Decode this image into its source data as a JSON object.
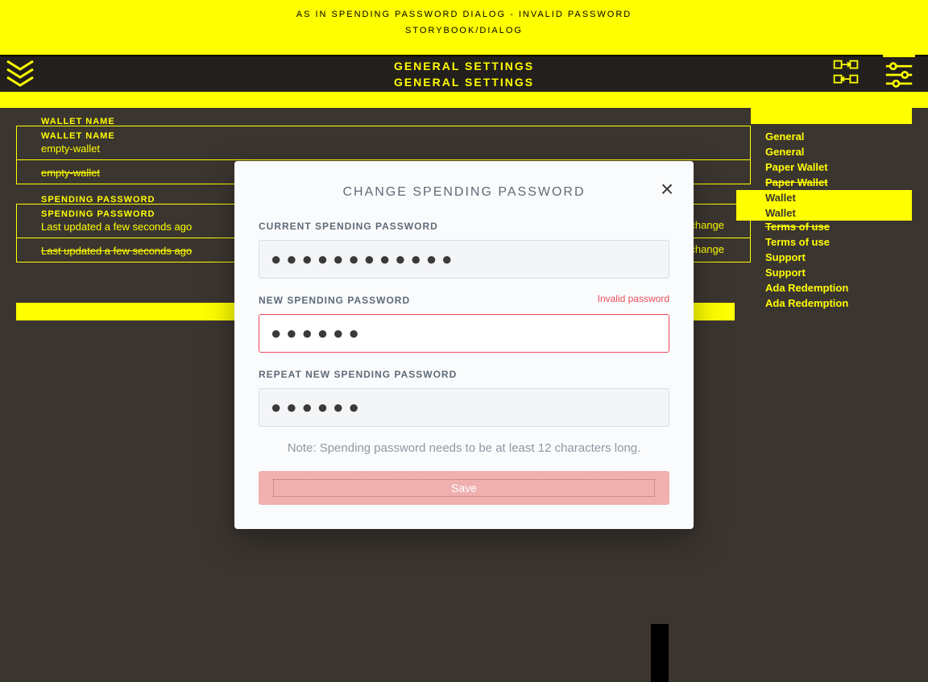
{
  "announcement": {
    "line1": "AS IN SPENDING PASSWORD DIALOG - INVALID PASSWORD",
    "line2": "STORYBOOK/DIALOG"
  },
  "header": {
    "title1": "GENERAL SETTINGS",
    "title2": "GENERAL SETTINGS"
  },
  "wallet": {
    "name_label": "WALLET NAME",
    "name_value": "empty-wallet",
    "password_label": "SPENDING PASSWORD",
    "password_value": "Last updated a few seconds ago",
    "change_link": "change"
  },
  "sidebar": {
    "items": [
      {
        "label": "General"
      },
      {
        "label": "General"
      },
      {
        "label": "Paper Wallet"
      },
      {
        "label": "Paper Wallet"
      },
      {
        "label": "Wallet"
      },
      {
        "label": "Wallet"
      },
      {
        "label": "Terms of use"
      },
      {
        "label": "Terms of use"
      },
      {
        "label": "Support"
      },
      {
        "label": "Support"
      },
      {
        "label": "Ada Redemption"
      },
      {
        "label": "Ada Redemption"
      }
    ]
  },
  "modal": {
    "title": "CHANGE SPENDING PASSWORD",
    "current_label": "CURRENT SPENDING PASSWORD",
    "current_value": "●●●●●●●●●●●●",
    "new_label": "NEW SPENDING PASSWORD",
    "new_error": "Invalid password",
    "new_value": "●●●●●●",
    "repeat_label": "REPEAT NEW SPENDING PASSWORD",
    "repeat_value": "●●●●●●",
    "note": "Note: Spending password needs to be at least 12 characters long.",
    "save": "Save"
  }
}
